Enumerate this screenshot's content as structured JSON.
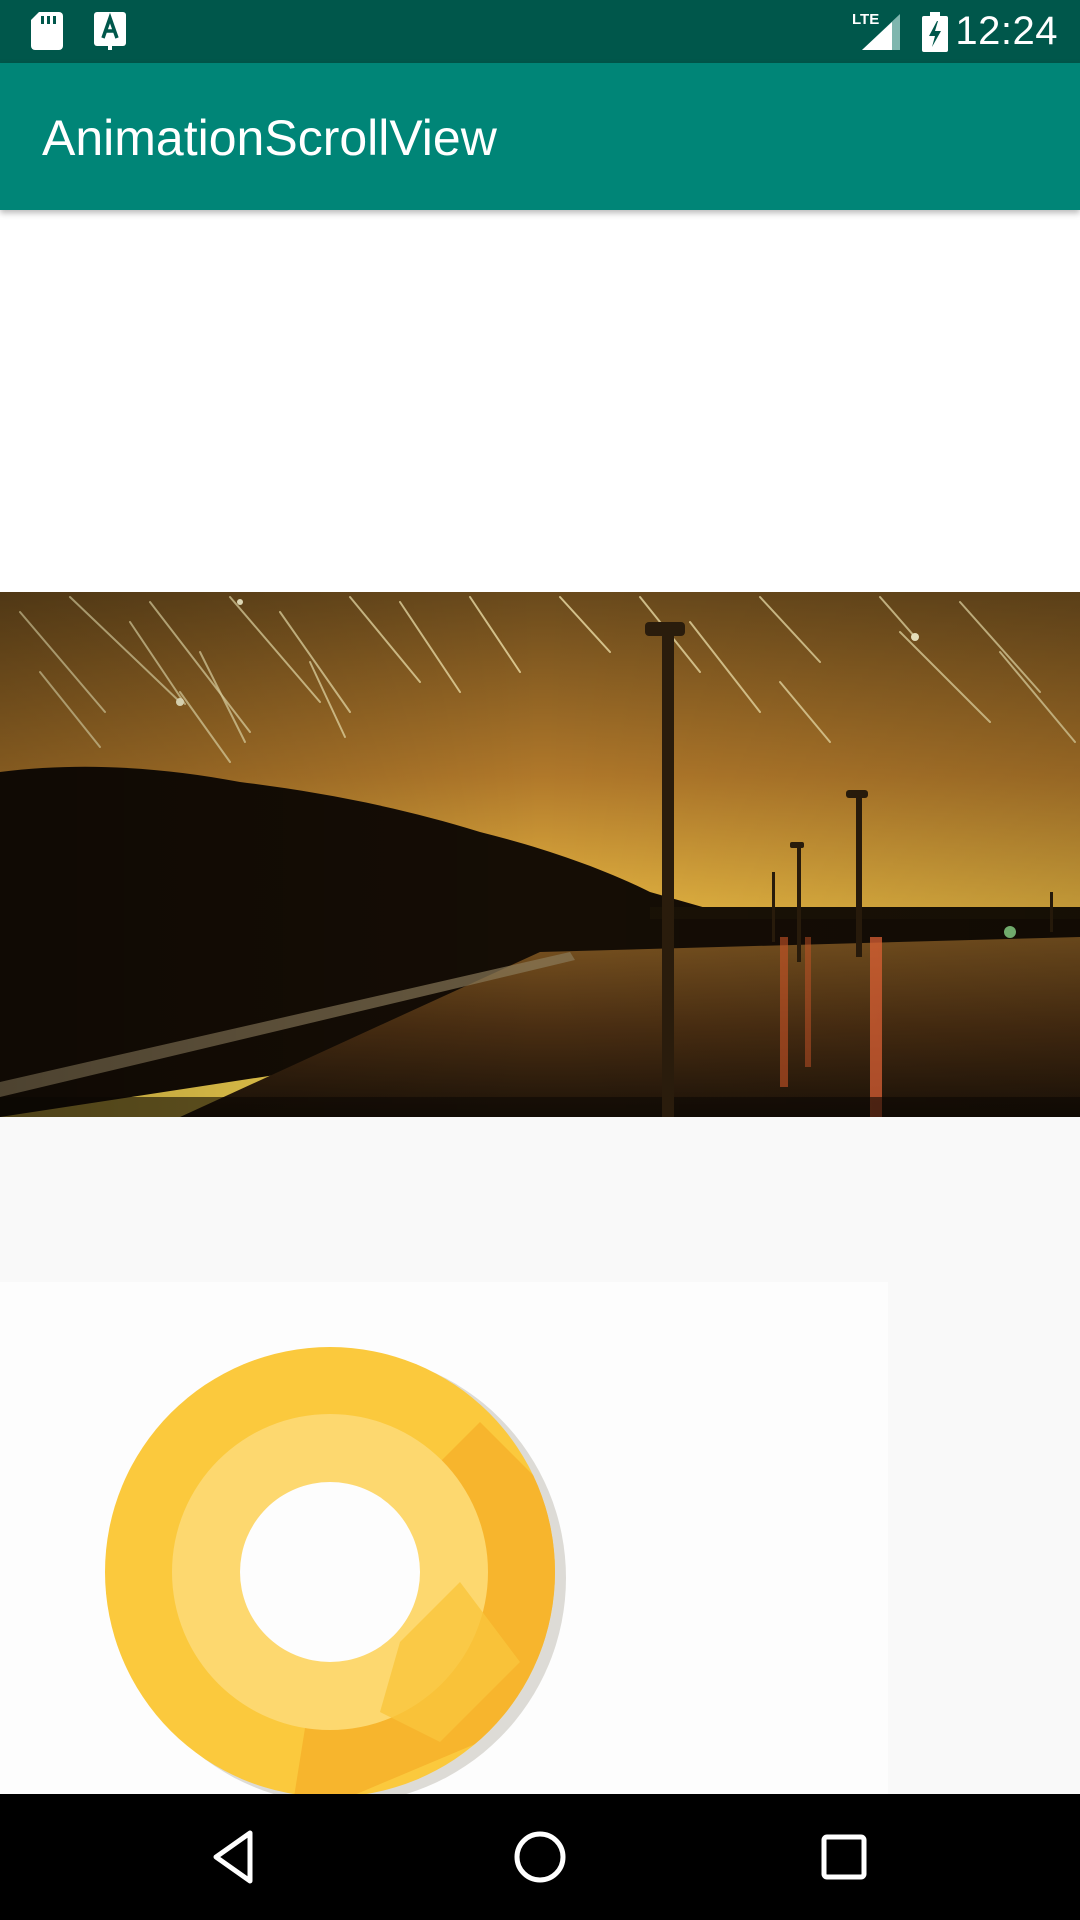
{
  "status_bar": {
    "time": "12:24",
    "network": "LTE",
    "icons": [
      "sd-card-icon",
      "app-notification-icon",
      "lte-signal-icon",
      "battery-charging-icon"
    ],
    "background_color": "#00574b"
  },
  "app_bar": {
    "title": "AnimationScrollView",
    "background_color": "#008577"
  },
  "content": {
    "images": [
      {
        "name": "night-windmill-photo",
        "description_icon": "image-icon"
      },
      {
        "name": "android-oreo-logo",
        "description_icon": "image-icon"
      }
    ],
    "logo_colors": {
      "outer": "#fbc93d",
      "inner_ring": "#fdd86f",
      "shadow": "#f7b52d"
    }
  },
  "nav_bar": {
    "buttons": [
      "back-icon",
      "home-icon",
      "recents-icon"
    ]
  }
}
